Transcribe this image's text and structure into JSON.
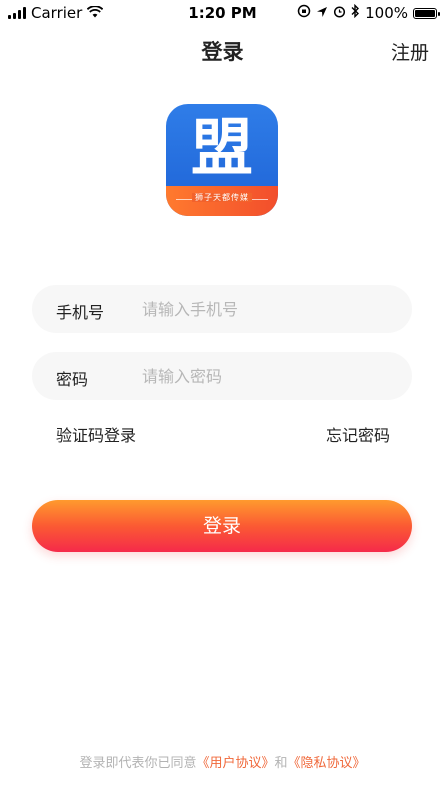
{
  "status_bar": {
    "carrier": "Carrier",
    "time": "1:20 PM",
    "battery": "100%"
  },
  "nav": {
    "title": "登录",
    "right_action": "注册"
  },
  "logo": {
    "character": "盟",
    "subtitle": "狮子天都传媒"
  },
  "form": {
    "phone_label": "手机号",
    "phone_placeholder": "请输入手机号",
    "password_label": "密码",
    "password_placeholder": "请输入密码",
    "sms_login_link": "验证码登录",
    "forgot_password_link": "忘记密码",
    "submit_label": "登录"
  },
  "footer": {
    "prefix": "登录即代表你已同意",
    "user_agreement": "《用户协议》",
    "conjunction": "和",
    "privacy_policy": "《隐私协议》"
  },
  "colors": {
    "accent_orange": "#ff9a2e",
    "accent_red": "#f52a4a",
    "link_orange": "#f0683a",
    "logo_blue": "#2f7de8"
  }
}
